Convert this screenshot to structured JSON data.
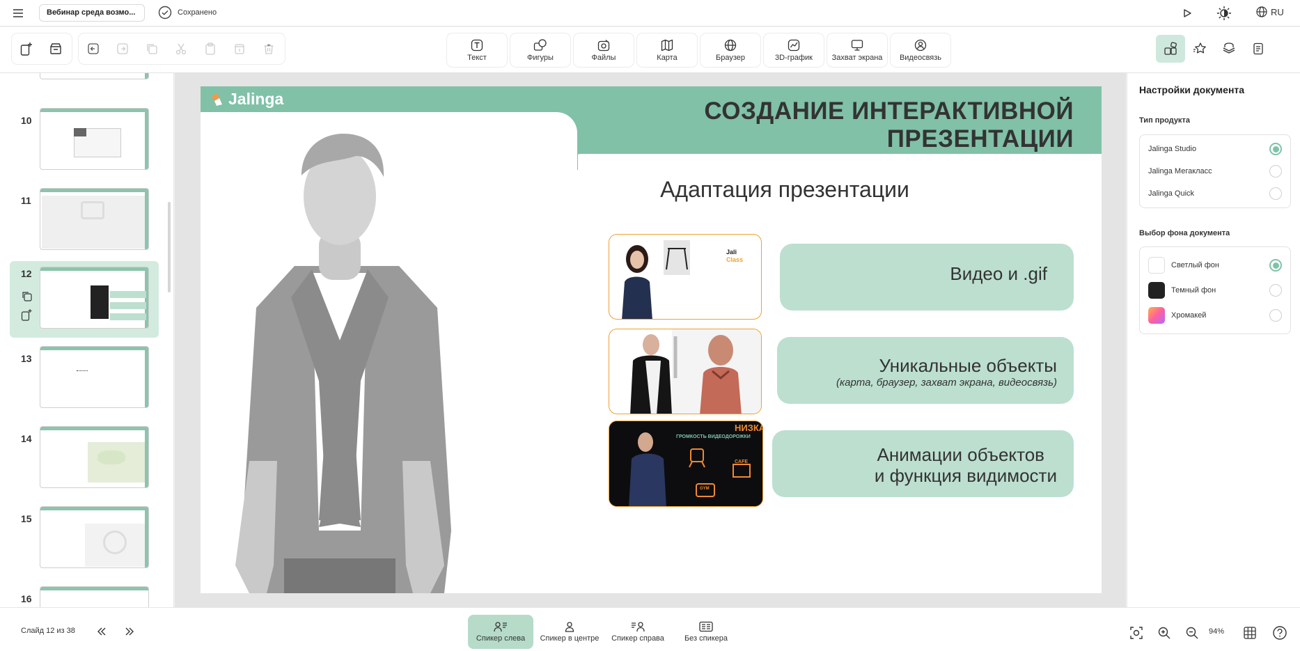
{
  "header": {
    "document_name": "Вебинар среда возмо...",
    "save_status": "Сохранено",
    "language": "RU"
  },
  "toolbar": {
    "tools": [
      {
        "label": "Текст",
        "icon": "text-icon"
      },
      {
        "label": "Фигуры",
        "icon": "shapes-icon"
      },
      {
        "label": "Файлы",
        "icon": "files-icon"
      },
      {
        "label": "Карта",
        "icon": "map-icon"
      },
      {
        "label": "Браузер",
        "icon": "globe-icon"
      },
      {
        "label": "3D-график",
        "icon": "chart-3d-icon"
      },
      {
        "label": "Захват экрана",
        "icon": "monitor-icon"
      },
      {
        "label": "Видеосвязь",
        "icon": "video-call-icon"
      }
    ]
  },
  "slides_panel": {
    "slide_numbers": [
      "10",
      "11",
      "12",
      "13",
      "14",
      "15",
      "16"
    ],
    "selected": "12"
  },
  "slide": {
    "logo_text": "Jalinga",
    "title_line1": "СОЗДАНИЕ ИНТЕРАКТИВНОЙ",
    "title_line2": "ПРЕЗЕНТАЦИИ",
    "subtitle": "Адаптация презентации",
    "item1": "Видео и .gif",
    "item2_title": "Уникальные объекты",
    "item2_sub": "(карта, браузер, захват экрана, видеосвязь)",
    "item3_line1": "Анимации объектов",
    "item3_line2": "и функция видимости",
    "photo1_text_line1": "Jali",
    "photo1_text_line2": "Class",
    "photo3_text_line1": "НИЗКАЯ",
    "photo3_text_line2": "ГРОМКОСТЬ ВИДЕОДОРОЖКИ",
    "photo3_cafe": "CAFE",
    "photo3_gym": "GYM"
  },
  "settings": {
    "title": "Настройки документа",
    "product_heading": "Тип продукта",
    "products": [
      {
        "label": "Jalinga Studio",
        "selected": true
      },
      {
        "label": "Jalinga Мегакласс",
        "selected": false
      },
      {
        "label": "Jalinga Quick",
        "selected": false
      }
    ],
    "background_heading": "Выбор фона документа",
    "backgrounds": [
      {
        "label": "Светлый фон",
        "color": "#ffffff",
        "selected": true
      },
      {
        "label": "Темный фон",
        "color": "#222222",
        "selected": false
      },
      {
        "label": "Хромакей",
        "color": "#ff6fa5",
        "selected": false
      }
    ]
  },
  "bottom": {
    "slide_counter": "Слайд 12 из 38",
    "layouts": [
      {
        "label": "Спикер слева",
        "active": true
      },
      {
        "label": "Спикер в центре",
        "active": false
      },
      {
        "label": "Спикер справа",
        "active": false
      },
      {
        "label": "Без спикера",
        "active": false
      }
    ],
    "zoom": "94%"
  },
  "colors": {
    "accent": "#80c1a8",
    "pill": "#bcdfd0",
    "photo_border": "#f0a030"
  }
}
